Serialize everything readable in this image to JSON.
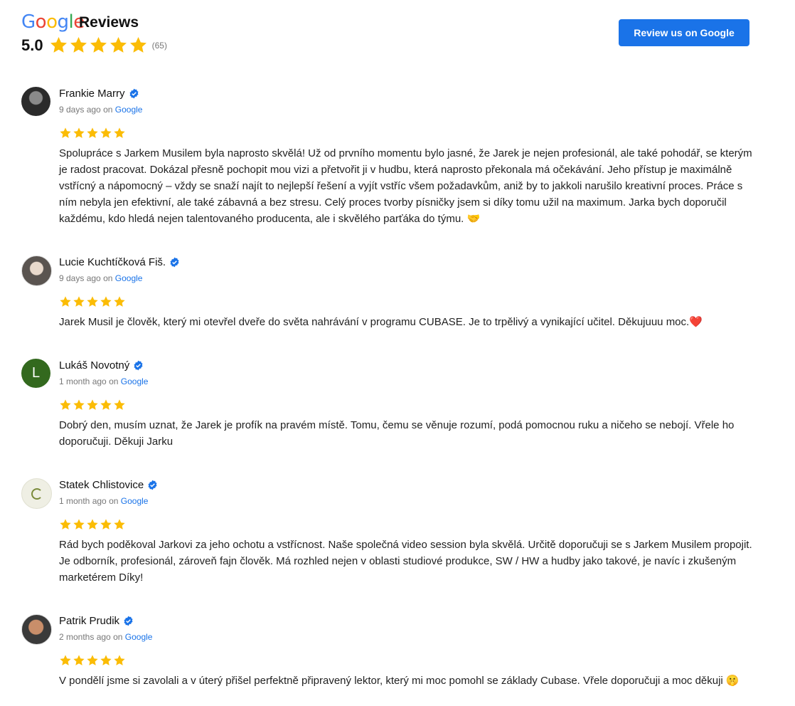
{
  "header": {
    "logo_letters": [
      "G",
      "o",
      "o",
      "g",
      "l",
      "e"
    ],
    "title": "Reviews",
    "rating": "5.0",
    "count": "(65)",
    "cta_label": "Review us on Google",
    "star_color": "#FBBC05",
    "accent": "#1a73e8"
  },
  "reviews": [
    {
      "name": "Frankie Marry",
      "time": "9 days ago",
      "on": "on",
      "source": "Google",
      "stars": 5,
      "avatar": "photo",
      "text": "Spolupráce s Jarkem Musilem byla naprosto skvělá! Už od prvního momentu bylo jasné, že Jarek je nejen profesionál, ale také pohodář, se kterým je radost pracovat. Dokázal přesně pochopit mou vizi a přetvořit ji v hudbu, která naprosto překonala má očekávání. Jeho přístup je maximálně vstřícný a nápomocný – vždy se snaží najít to nejlepší řešení a vyjít vstříc všem požadavkům, aniž by to jakkoli narušilo kreativní proces. Práce s ním nebyla jen efektivní, ale také zábavná a bez stresu. Celý proces tvorby písničky jsem si díky tomu užil na maximum. Jarka bych doporučil každému, kdo hledá nejen talentovaného producenta, ale i skvělého parťáka do týmu. 🤝"
    },
    {
      "name": "Lucie Kuchtíčková Fiš.",
      "time": "9 days ago",
      "on": "on",
      "source": "Google",
      "stars": 5,
      "avatar": "photo",
      "text": "Jarek Musil je člověk, který mi otevřel dveře do světa nahrávání v programu CUBASE. Je to trpělivý a vynikající učitel. Děkujuuu moc.❤️"
    },
    {
      "name": "Lukáš Novotný",
      "time": "1 month ago",
      "on": "on",
      "source": "Google",
      "stars": 5,
      "avatar_letter": "L",
      "text": "Dobrý den, musím uznat, že Jarek je profík na pravém místě. Tomu, čemu se věnuje rozumí, podá pomocnou ruku a ničeho se nebojí. Vřele ho doporučuji. Děkuji Jarku"
    },
    {
      "name": "Statek Chlistovice",
      "time": "1 month ago",
      "on": "on",
      "source": "Google",
      "stars": 5,
      "avatar": "logo",
      "text": "Rád bych poděkoval Jarkovi za jeho ochotu a vstřícnost. Naše společná video session byla skvělá. Určitě doporučuji se s Jarkem Musilem propojit. Je odborník, profesionál, zároveň fajn člověk. Má rozhled nejen v oblasti studiové produkce, SW / HW a hudby jako takové, je navíc i zkušeným marketérem Díky!"
    },
    {
      "name": "Patrik Prudik",
      "time": "2 months ago",
      "on": "on",
      "source": "Google",
      "stars": 5,
      "avatar": "photo",
      "text": "V pondělí jsme si zavolali a v úterý přišel perfektně připravený lektor, který mi moc pomohl se základy Cubase. Vřele doporučuji a moc děkuji 🤫"
    }
  ]
}
